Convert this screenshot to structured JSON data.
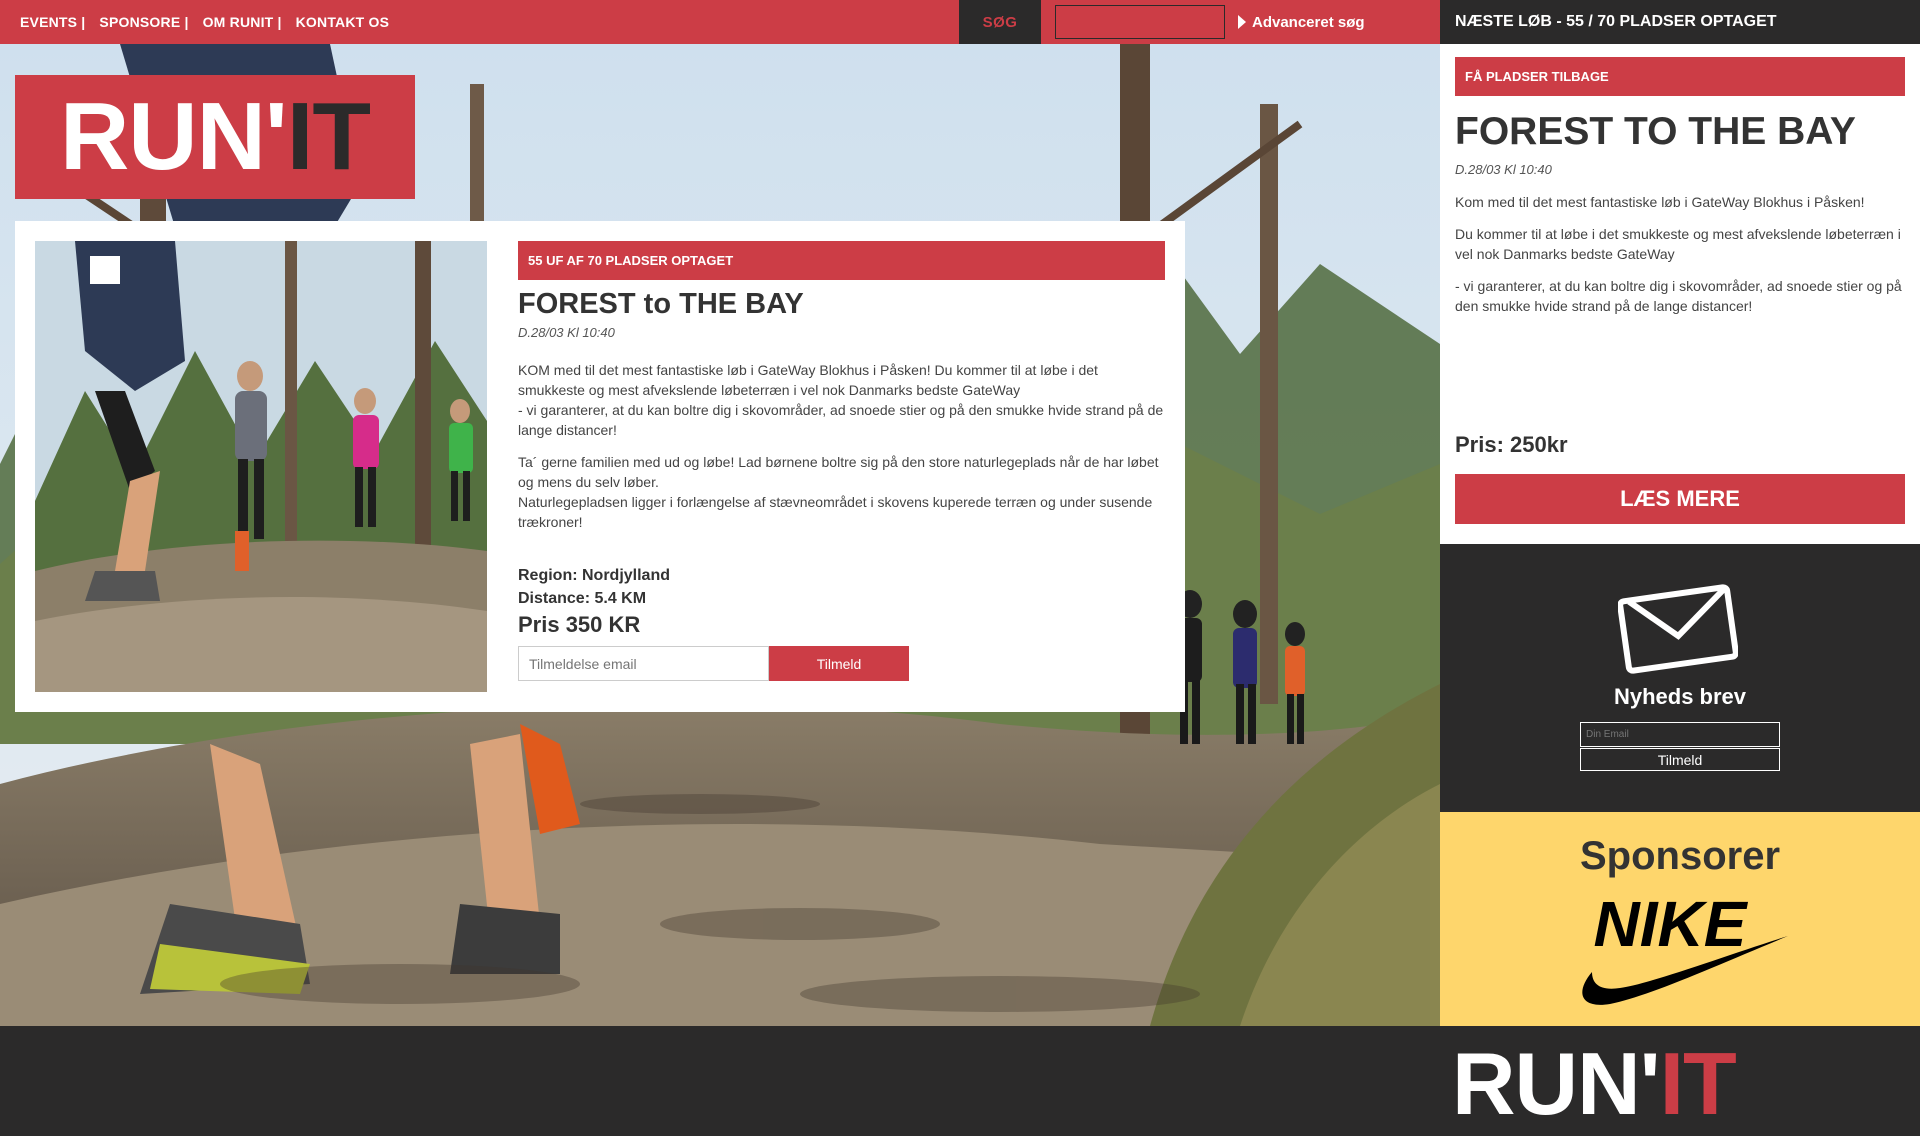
{
  "nav": {
    "items": [
      {
        "label": "EVENTS |"
      },
      {
        "label": "SPONSORE |"
      },
      {
        "label": "OM RUNIT |"
      },
      {
        "label": "KONTAKT OS"
      }
    ],
    "search_label": "SØG",
    "search_value": "",
    "advanced_search_label": "Advanceret søg"
  },
  "logo": {
    "part1": "RUN'",
    "part2": "IT"
  },
  "event": {
    "banner": "55 UF AF 70 PLADSER OPTAGET",
    "title": "FOREST to THE BAY",
    "date": "D.28/03 Kl 10:40",
    "desc1": "KOM med til det mest fantastiske løb i GateWay Blokhus i Påsken! Du kommer til at løbe i det smukkeste og mest afvekslende løbeterræn i vel nok Danmarks bedste GateWay\n- vi garanterer, at du kan boltre dig i skovområder, ad snoede stier og på den smukke hvide strand på de lange distancer!",
    "desc2": "Ta´ gerne familien med ud og løbe! Lad børnene boltre sig på den store naturlegeplads når de har løbet og mens du selv løber.\nNaturlegepladsen ligger i forlængelse af stævneområdet i skovens kuperede terræn og under susende trækroner!",
    "region": "Region: Nordjylland",
    "distance": "Distance: 5.4 KM",
    "price": "Pris 350 KR",
    "email_placeholder": "Tilmeldelse email",
    "signup_label": "Tilmeld"
  },
  "sidebar": {
    "header": "NÆSTE LØB - 55 / 70 PLADSER OPTAGET",
    "banner": "FÅ PLADSER TILBAGE",
    "title": "FOREST TO THE BAY",
    "date": "D.28/03 Kl 10:40",
    "desc1": "Kom med til det mest fantastiske løb i GateWay Blokhus i Påsken!",
    "desc2": "Du kommer til at løbe i det smukkeste og mest afvekslende løbeterræn i vel nok Danmarks bedste GateWay",
    "desc3": "- vi garanterer, at du kan boltre dig i skovområder, ad snoede stier og på den smukke hvide strand på de lange distancer!",
    "price": "Pris: 250kr",
    "read_more": "LÆS MERE"
  },
  "newsletter": {
    "icon": "envelope-icon",
    "title": "Nyheds brev",
    "email_placeholder": "Din Email",
    "signup_label": "Tilmeld"
  },
  "sponsors": {
    "title": "Sponsorer",
    "logo_text": "NIKE"
  },
  "footer": {
    "logo_part1": "RUN'",
    "logo_part2": "IT"
  },
  "colors": {
    "accent": "#cc3d46",
    "dark": "#2b2a2a",
    "sponsor_bg": "#fed66c",
    "white": "#ffffff"
  }
}
